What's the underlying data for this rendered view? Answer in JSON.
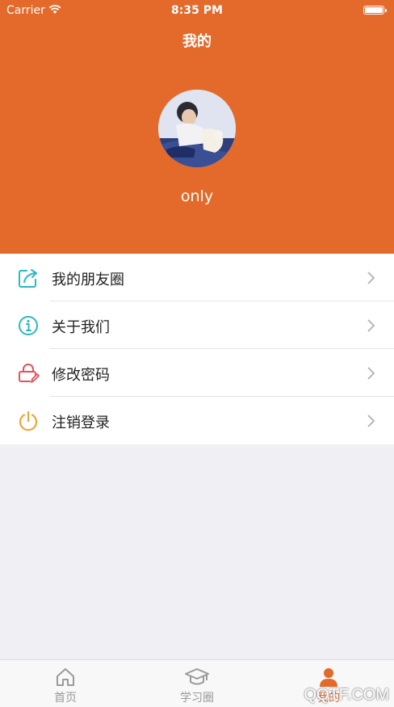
{
  "status_bar": {
    "carrier": "Carrier",
    "time": "8:35 PM"
  },
  "header": {
    "title": "我的",
    "username": "only"
  },
  "menu": {
    "items": [
      {
        "label": "我的朋友圈",
        "icon": "share-icon",
        "color": "#2bb8c4"
      },
      {
        "label": "关于我们",
        "icon": "info-icon",
        "color": "#2bb8c4"
      },
      {
        "label": "修改密码",
        "icon": "lock-edit-icon",
        "color": "#e8505b"
      },
      {
        "label": "注销登录",
        "icon": "power-icon",
        "color": "#f0a63a"
      }
    ]
  },
  "tabbar": {
    "tabs": [
      {
        "label": "首页",
        "icon": "home-icon"
      },
      {
        "label": "学习圈",
        "icon": "graduation-cap-icon"
      },
      {
        "label": "我的",
        "icon": "person-icon",
        "active": true
      }
    ]
  },
  "watermark": "QQTF.COM",
  "colors": {
    "accent": "#e36a2a",
    "background": "#efeff4"
  }
}
